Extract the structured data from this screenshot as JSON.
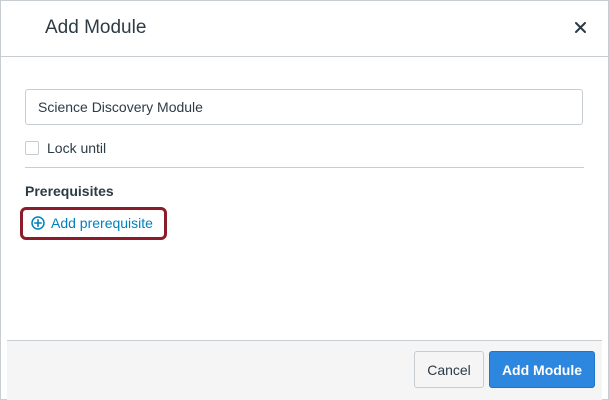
{
  "dialog": {
    "title": "Add Module",
    "close_icon": "close-icon"
  },
  "form": {
    "module_name_value": "Science Discovery Module",
    "lock_until_label": "Lock until",
    "lock_until_checked": false,
    "prerequisites_heading": "Prerequisites",
    "add_prerequisite_label": "Add prerequisite",
    "add_prerequisite_icon": "plus-circle-icon"
  },
  "footer": {
    "cancel_label": "Cancel",
    "submit_label": "Add Module"
  },
  "colors": {
    "link": "#0081bd",
    "primary_button": "#2d87de",
    "highlight": "#8d1c2a",
    "text": "#2d3b45",
    "border": "#c7cdd1",
    "footer_bg": "#f5f5f5"
  }
}
